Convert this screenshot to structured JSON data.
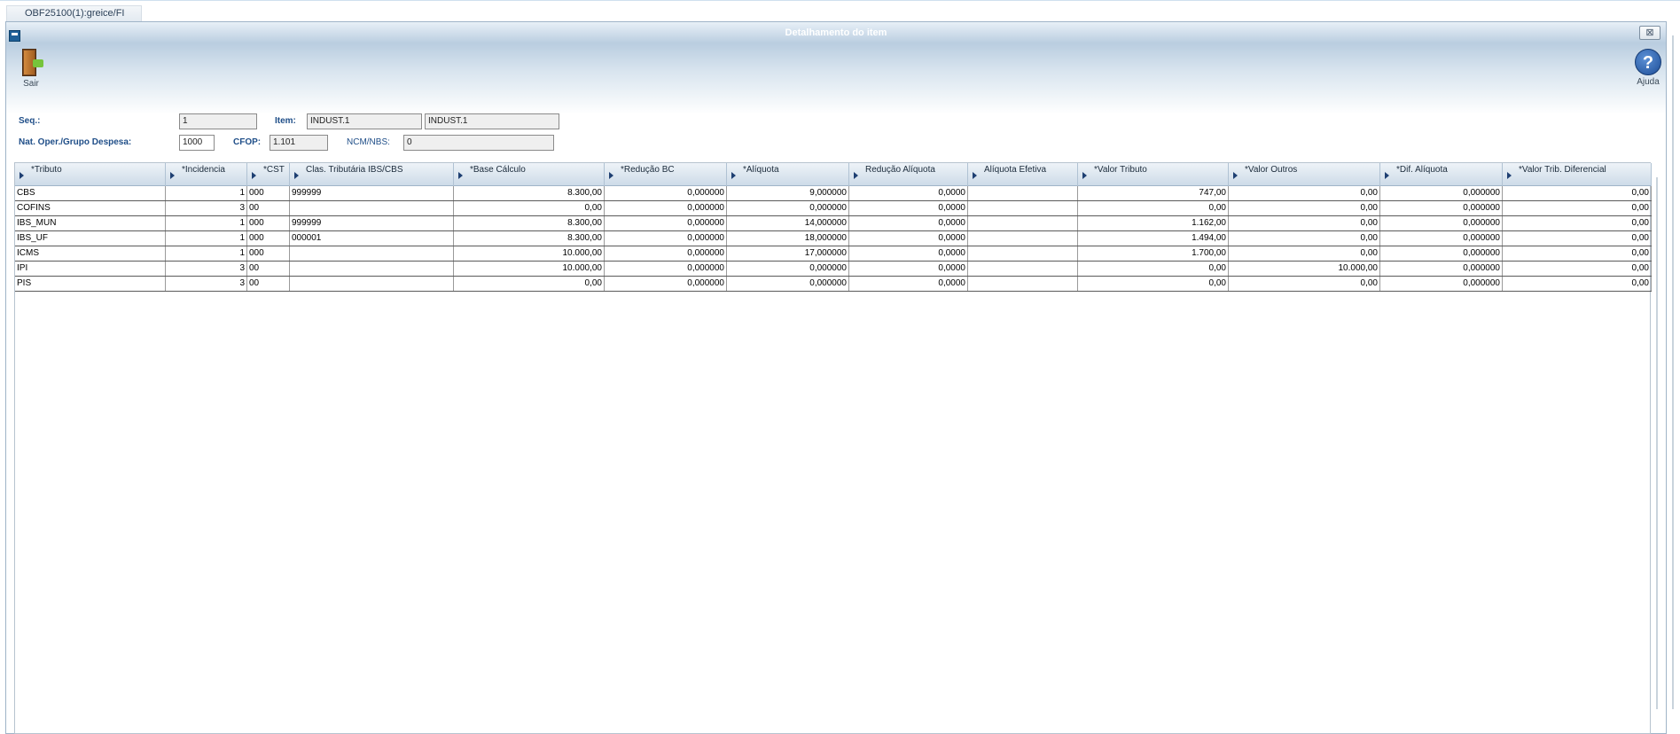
{
  "tab": {
    "label": "OBF25100(1):greice/FI"
  },
  "window": {
    "title": "Detalhamento do item",
    "close_label": "⊠"
  },
  "toolbar": {
    "sair_label": "Sair",
    "ajuda_label": "Ajuda"
  },
  "form": {
    "seq_label": "Seq.:",
    "seq_value": "1",
    "item_label": "Item:",
    "item_code": "INDUST.1",
    "item_desc": "INDUST.1",
    "nat_label": "Nat. Oper./Grupo Despesa:",
    "nat_value": "1000",
    "cfop_label": "CFOP:",
    "cfop_value": "1.101",
    "ncm_label": "NCM/NBS:",
    "ncm_value": "0"
  },
  "grid": {
    "columns": [
      "*Tributo",
      "*Incidencia",
      "*CST",
      "Clas. Tributária IBS/CBS",
      "*Base Cálculo",
      "*Redução BC",
      "*Alíquota",
      "Redução Alíquota",
      "Alíquota Efetiva",
      "*Valor Tributo",
      "*Valor Outros",
      "*Dif. Alíquota",
      "*Valor Trib. Diferencial"
    ],
    "rows": [
      [
        "CBS",
        "1",
        "000",
        "999999",
        "8.300,00",
        "0,000000",
        "9,000000",
        "0,0000",
        "",
        "747,00",
        "0,00",
        "0,000000",
        "0,00"
      ],
      [
        "COFINS",
        "3",
        "00",
        "",
        "0,00",
        "0,000000",
        "0,000000",
        "0,0000",
        "",
        "0,00",
        "0,00",
        "0,000000",
        "0,00"
      ],
      [
        "IBS_MUN",
        "1",
        "000",
        "999999",
        "8.300,00",
        "0,000000",
        "14,000000",
        "0,0000",
        "",
        "1.162,00",
        "0,00",
        "0,000000",
        "0,00"
      ],
      [
        "IBS_UF",
        "1",
        "000",
        "000001",
        "8.300,00",
        "0,000000",
        "18,000000",
        "0,0000",
        "",
        "1.494,00",
        "0,00",
        "0,000000",
        "0,00"
      ],
      [
        "ICMS",
        "1",
        "000",
        "",
        "10.000,00",
        "0,000000",
        "17,000000",
        "0,0000",
        "",
        "1.700,00",
        "0,00",
        "0,000000",
        "0,00"
      ],
      [
        "IPI",
        "3",
        "00",
        "",
        "10.000,00",
        "0,000000",
        "0,000000",
        "0,0000",
        "",
        "0,00",
        "10.000,00",
        "0,000000",
        "0,00"
      ],
      [
        "PIS",
        "3",
        "00",
        "",
        "0,00",
        "0,000000",
        "0,000000",
        "0,0000",
        "",
        "0,00",
        "0,00",
        "0,000000",
        "0,00"
      ]
    ]
  },
  "icons": {
    "sair": "exit-door-icon",
    "ajuda": "help-icon",
    "window": "window-menu-icon"
  }
}
